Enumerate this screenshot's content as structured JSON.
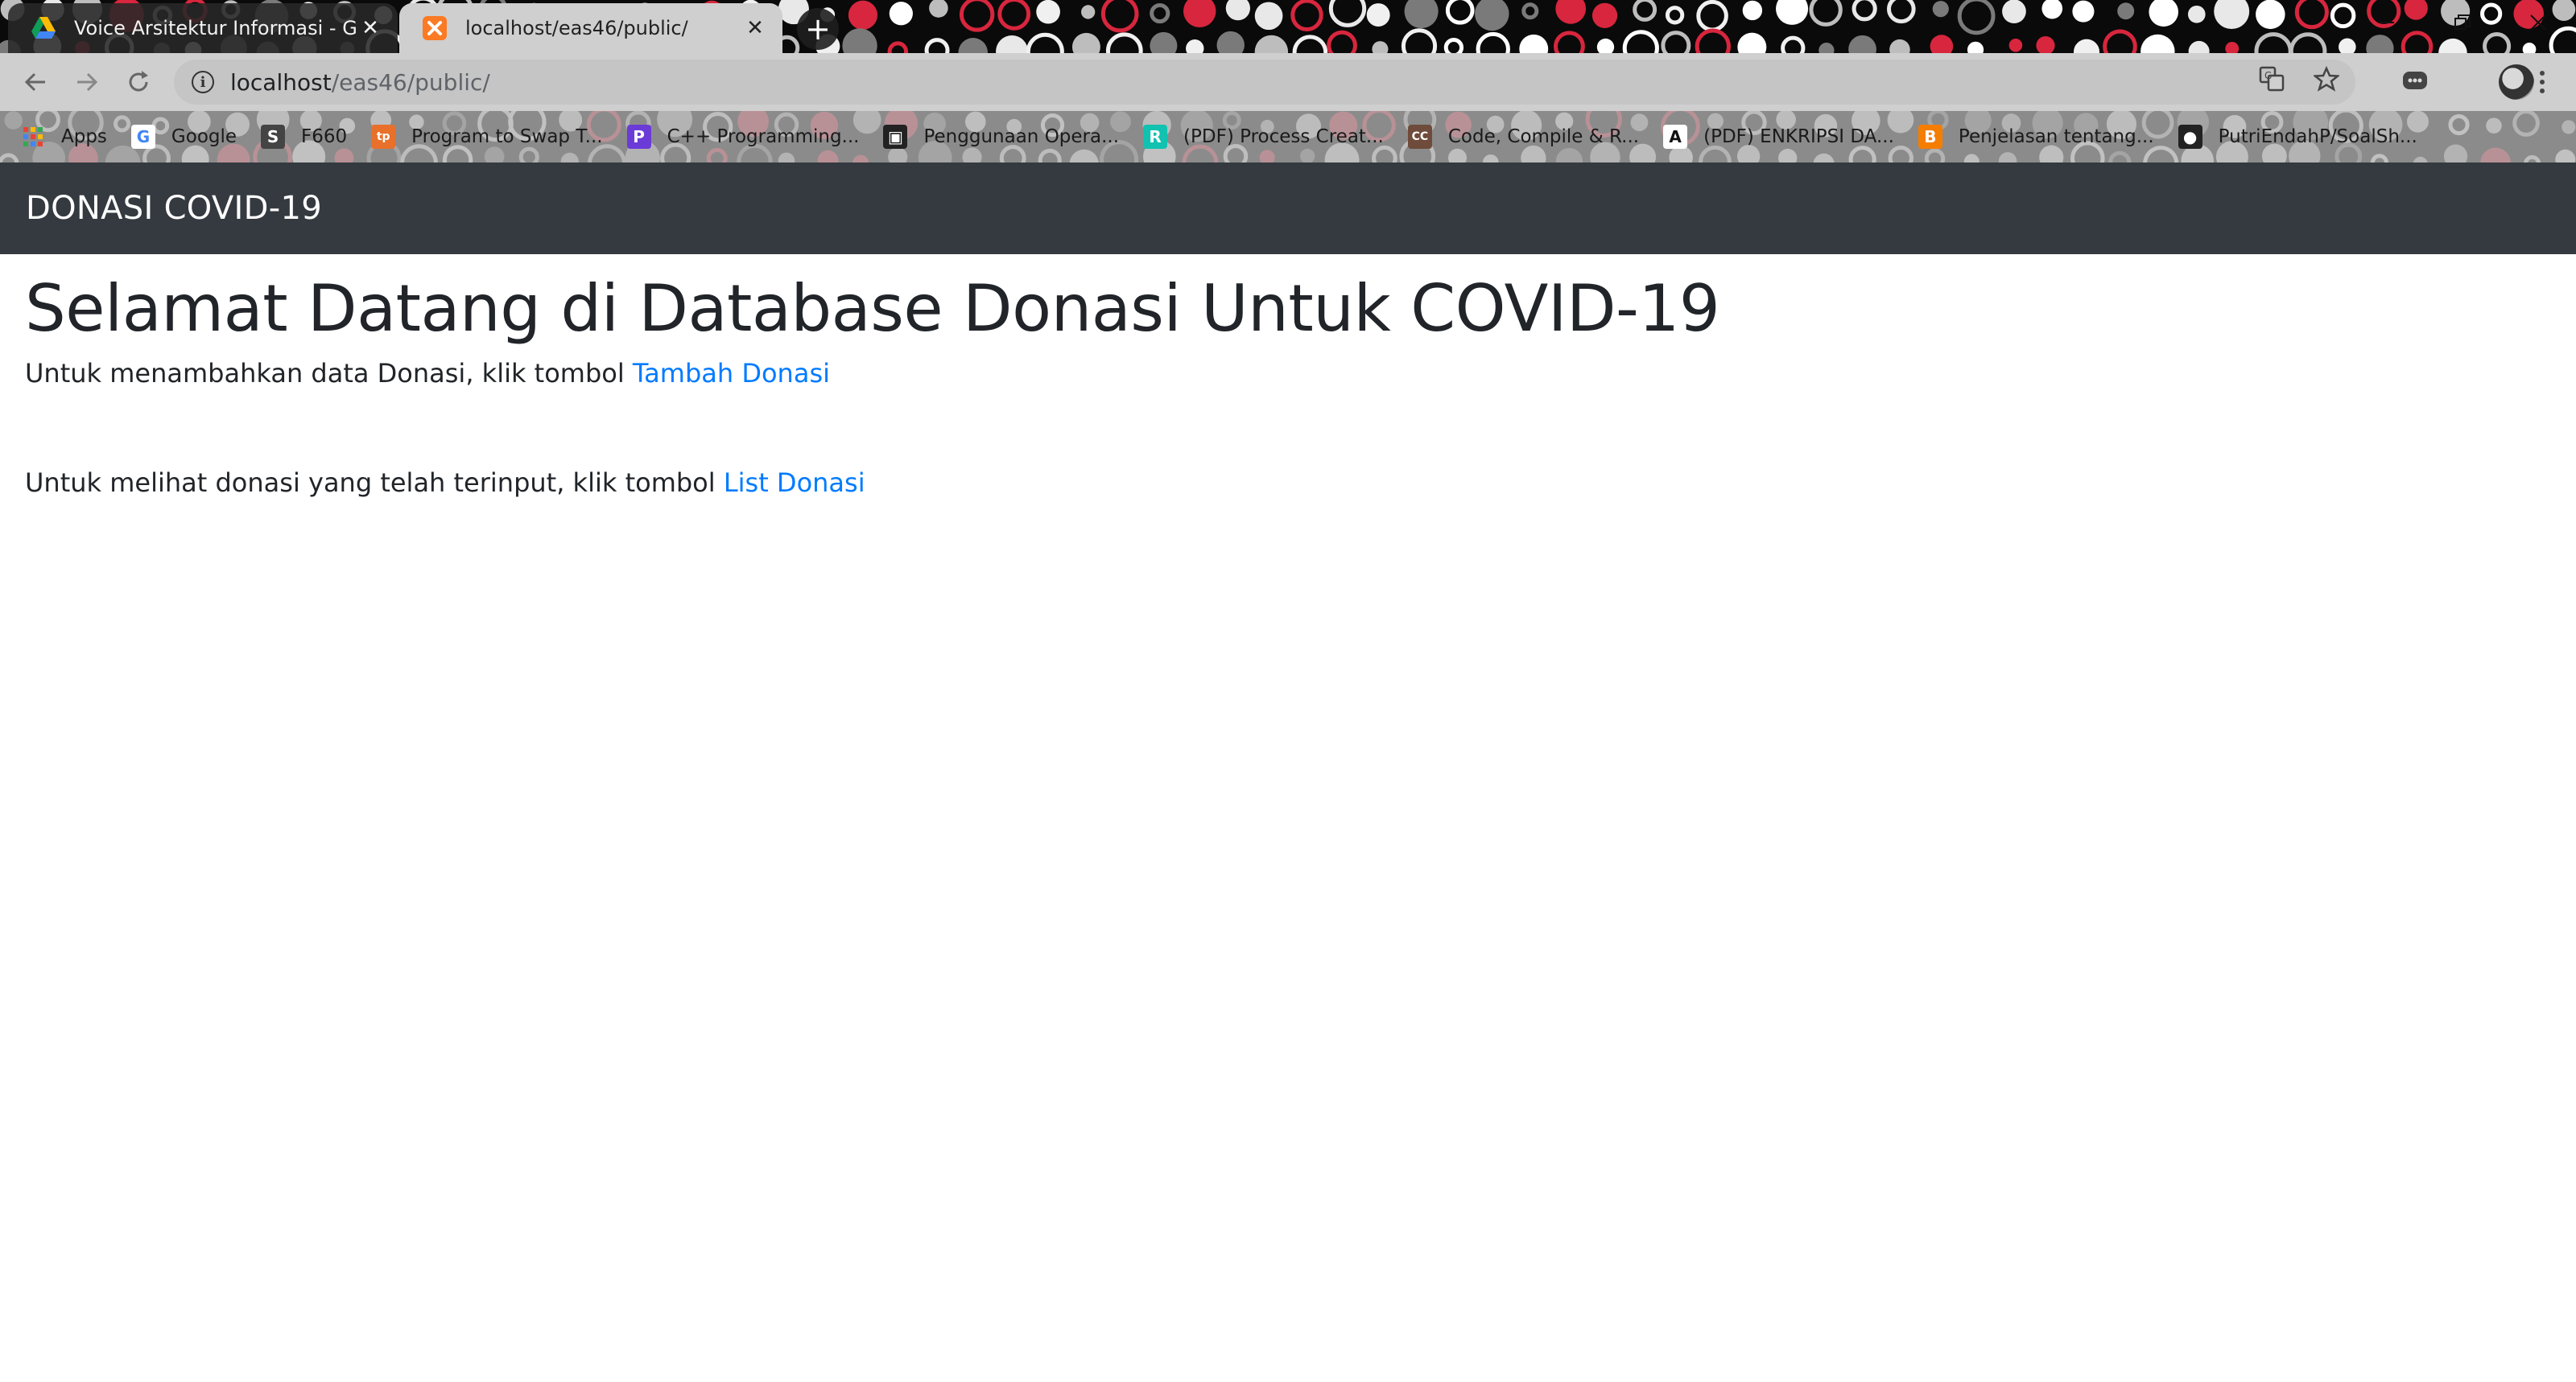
{
  "browser": {
    "tabs": [
      {
        "title": "Voice Arsitektur Informasi - Goo",
        "active": false,
        "favicon": "google-drive-icon"
      },
      {
        "title": "localhost/eas46/public/",
        "active": true,
        "favicon": "xampp-icon"
      }
    ],
    "new_tab_label": "+",
    "close_label": "✕",
    "url_host": "localhost",
    "url_path": "/eas46/public/",
    "bookmarks": [
      {
        "label": "Apps",
        "icon": "apps-grid-icon",
        "color": "#4285f4",
        "glyph": ""
      },
      {
        "label": "Google",
        "icon": "google-icon",
        "color": "#ffffff",
        "glyph": "G"
      },
      {
        "label": "F660",
        "icon": "router-icon",
        "color": "#444444",
        "glyph": "S"
      },
      {
        "label": "Program to Swap T...",
        "icon": "tutorialspoint-icon",
        "color": "#e8702a",
        "glyph": "tp"
      },
      {
        "label": "C++ Programming...",
        "icon": "programiz-icon",
        "color": "#6b3bd8",
        "glyph": "P"
      },
      {
        "label": "Penggunaan Opera...",
        "icon": "site-icon",
        "color": "#222222",
        "glyph": "▣"
      },
      {
        "label": "(PDF) Process Creat...",
        "icon": "researchgate-icon",
        "color": "#11c2b0",
        "glyph": "R"
      },
      {
        "label": "Code, Compile & R...",
        "icon": "codechef-icon",
        "color": "#6e4b3a",
        "glyph": "CC"
      },
      {
        "label": "(PDF) ENKRIPSI DA...",
        "icon": "academia-icon",
        "color": "#ffffff",
        "glyph": "A"
      },
      {
        "label": "Penjelasan tentang...",
        "icon": "blogger-icon",
        "color": "#f57d00",
        "glyph": "B"
      },
      {
        "label": "PutriEndahP/SoalSh...",
        "icon": "github-icon",
        "color": "#222222",
        "glyph": "●"
      }
    ]
  },
  "navbar": {
    "brand": "DONASI COVID-19"
  },
  "main": {
    "title": "Selamat Datang di Database Donasi Untuk COVID-19",
    "line1_text": "Untuk menambahkan data Donasi, klik tombol ",
    "line1_link": "Tambah Donasi",
    "line2_text": "Untuk melihat donasi yang telah terinput, klik tombol ",
    "line2_link": "List Donasi"
  },
  "colors": {
    "navbar_bg": "#343a40",
    "link": "#007bff",
    "text": "#212529"
  }
}
